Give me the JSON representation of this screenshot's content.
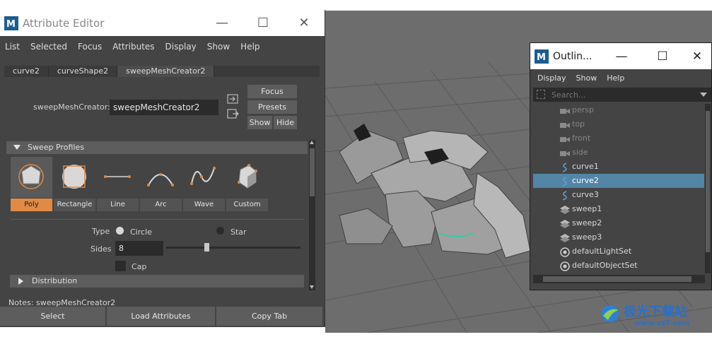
{
  "attribute_editor": {
    "title": "Attribute Editor",
    "menu": [
      "List",
      "Selected",
      "Focus",
      "Attributes",
      "Display",
      "Show",
      "Help"
    ],
    "tabs": [
      "curve2",
      "curveShape2",
      "sweepMeshCreator2"
    ],
    "active_tab": "sweepMeshCreator2",
    "node_label": "sweepMeshCreator:",
    "node_value": "sweepMeshCreator2",
    "buttons": {
      "focus": "Focus",
      "presets": "Presets",
      "show": "Show",
      "hide": "Hide"
    },
    "sweep_profiles": {
      "header": "Sweep Profiles",
      "profiles": [
        "Poly",
        "Rectangle",
        "Line",
        "Arc",
        "Wave",
        "Custom"
      ],
      "selected": "Poly"
    },
    "type_label": "Type",
    "type_options": [
      "Circle",
      "Star"
    ],
    "sides_label": "Sides",
    "sides_value": "8",
    "sides_slider_fraction": 0.3,
    "cap_label": "Cap",
    "distribution_header": "Distribution",
    "notes": "Notes:  sweepMeshCreator2",
    "bottom_buttons": [
      "Select",
      "Load Attributes",
      "Copy Tab"
    ]
  },
  "outliner": {
    "title": "Outlin...",
    "menu": [
      "Display",
      "Show",
      "Help"
    ],
    "search_placeholder": "Search...",
    "items": [
      {
        "label": "persp",
        "icon": "camera-icon",
        "state": "dim"
      },
      {
        "label": "top",
        "icon": "camera-icon",
        "state": "dim"
      },
      {
        "label": "front",
        "icon": "camera-icon",
        "state": "dim"
      },
      {
        "label": "side",
        "icon": "camera-icon",
        "state": "dim"
      },
      {
        "label": "curve1",
        "icon": "curve-icon",
        "state": "normal"
      },
      {
        "label": "curve2",
        "icon": "curve-icon",
        "state": "selected"
      },
      {
        "label": "curve3",
        "icon": "curve-icon",
        "state": "normal"
      },
      {
        "label": "sweep1",
        "icon": "mesh-icon",
        "state": "normal"
      },
      {
        "label": "sweep2",
        "icon": "mesh-icon",
        "state": "normal"
      },
      {
        "label": "sweep3",
        "icon": "mesh-icon",
        "state": "normal"
      },
      {
        "label": "defaultLightSet",
        "icon": "set-icon",
        "state": "normal"
      },
      {
        "label": "defaultObjectSet",
        "icon": "set-icon",
        "state": "normal"
      }
    ]
  },
  "watermark": {
    "text_cn": "极光下载站",
    "url": "www.xz7.com"
  },
  "colors": {
    "accent": "#e08a46",
    "selection": "#5285a6",
    "panel": "#444444",
    "viewport": "#6d6d6d"
  }
}
